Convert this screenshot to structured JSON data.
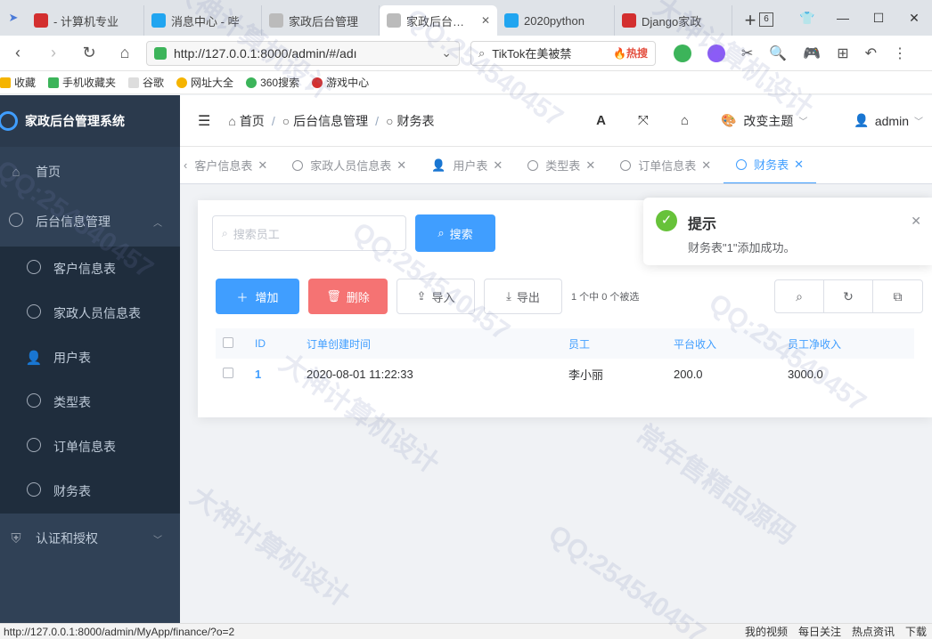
{
  "browser": {
    "tabs": [
      {
        "label": "- 计算机专业",
        "fav_color": "#d32f2f"
      },
      {
        "label": "消息中心 - 哔",
        "fav_color": "#21a5f0"
      },
      {
        "label": "家政后台管理",
        "fav_color": "#9e9e9e"
      },
      {
        "label": "家政后台管理",
        "fav_color": "#9e9e9e"
      },
      {
        "label": "2020python",
        "fav_color": "#21a5f0"
      },
      {
        "label": "Django家政",
        "fav_color": "#d32f2f"
      }
    ],
    "tab_badge": "6",
    "url": "http://127.0.0.1:8000/admin/#/adı",
    "search_text": "TikTok在美被禁",
    "search_hot": "🔥热搜",
    "bookmarks": [
      "收藏",
      "手机收藏夹",
      "谷歌",
      "网址大全",
      "360搜索",
      "游戏中心"
    ]
  },
  "sidebar": {
    "brand": "家政后台管理系统",
    "home": "首页",
    "group": "后台信息管理",
    "items": [
      "客户信息表",
      "家政人员信息表",
      "用户表",
      "类型表",
      "订单信息表",
      "财务表"
    ],
    "auth": "认证和授权"
  },
  "navbar": {
    "crumbs": [
      "首页",
      "后台信息管理",
      "财务表"
    ],
    "theme": "改变主题",
    "user": "admin"
  },
  "tags": [
    "客户信息表",
    "家政人员信息表",
    "用户表",
    "类型表",
    "订单信息表",
    "财务表"
  ],
  "search": {
    "placeholder": "搜索员工",
    "button": "搜索"
  },
  "ops": {
    "add": "增加",
    "delete": "删除",
    "import": "导入",
    "export": "导出",
    "selection": "1 个中 0 个被选"
  },
  "table": {
    "headers": [
      "ID",
      "订单创建时间",
      "员工",
      "平台收入",
      "员工净收入"
    ],
    "rows": [
      {
        "id": "1",
        "time": "2020-08-01 11:22:33",
        "staff": "李小丽",
        "platform": "200.0",
        "net": "3000.0"
      }
    ]
  },
  "notification": {
    "title": "提示",
    "message": "财务表\"1\"添加成功。"
  },
  "statusbar": {
    "url": "http://127.0.0.1:8000/admin/MyApp/finance/?o=2",
    "items": [
      "我的视频",
      "每日关注",
      "热点资讯",
      "下载"
    ]
  },
  "watermark": [
    "大神计算机设计",
    "QQ:254540457",
    "常年售精品源码"
  ]
}
